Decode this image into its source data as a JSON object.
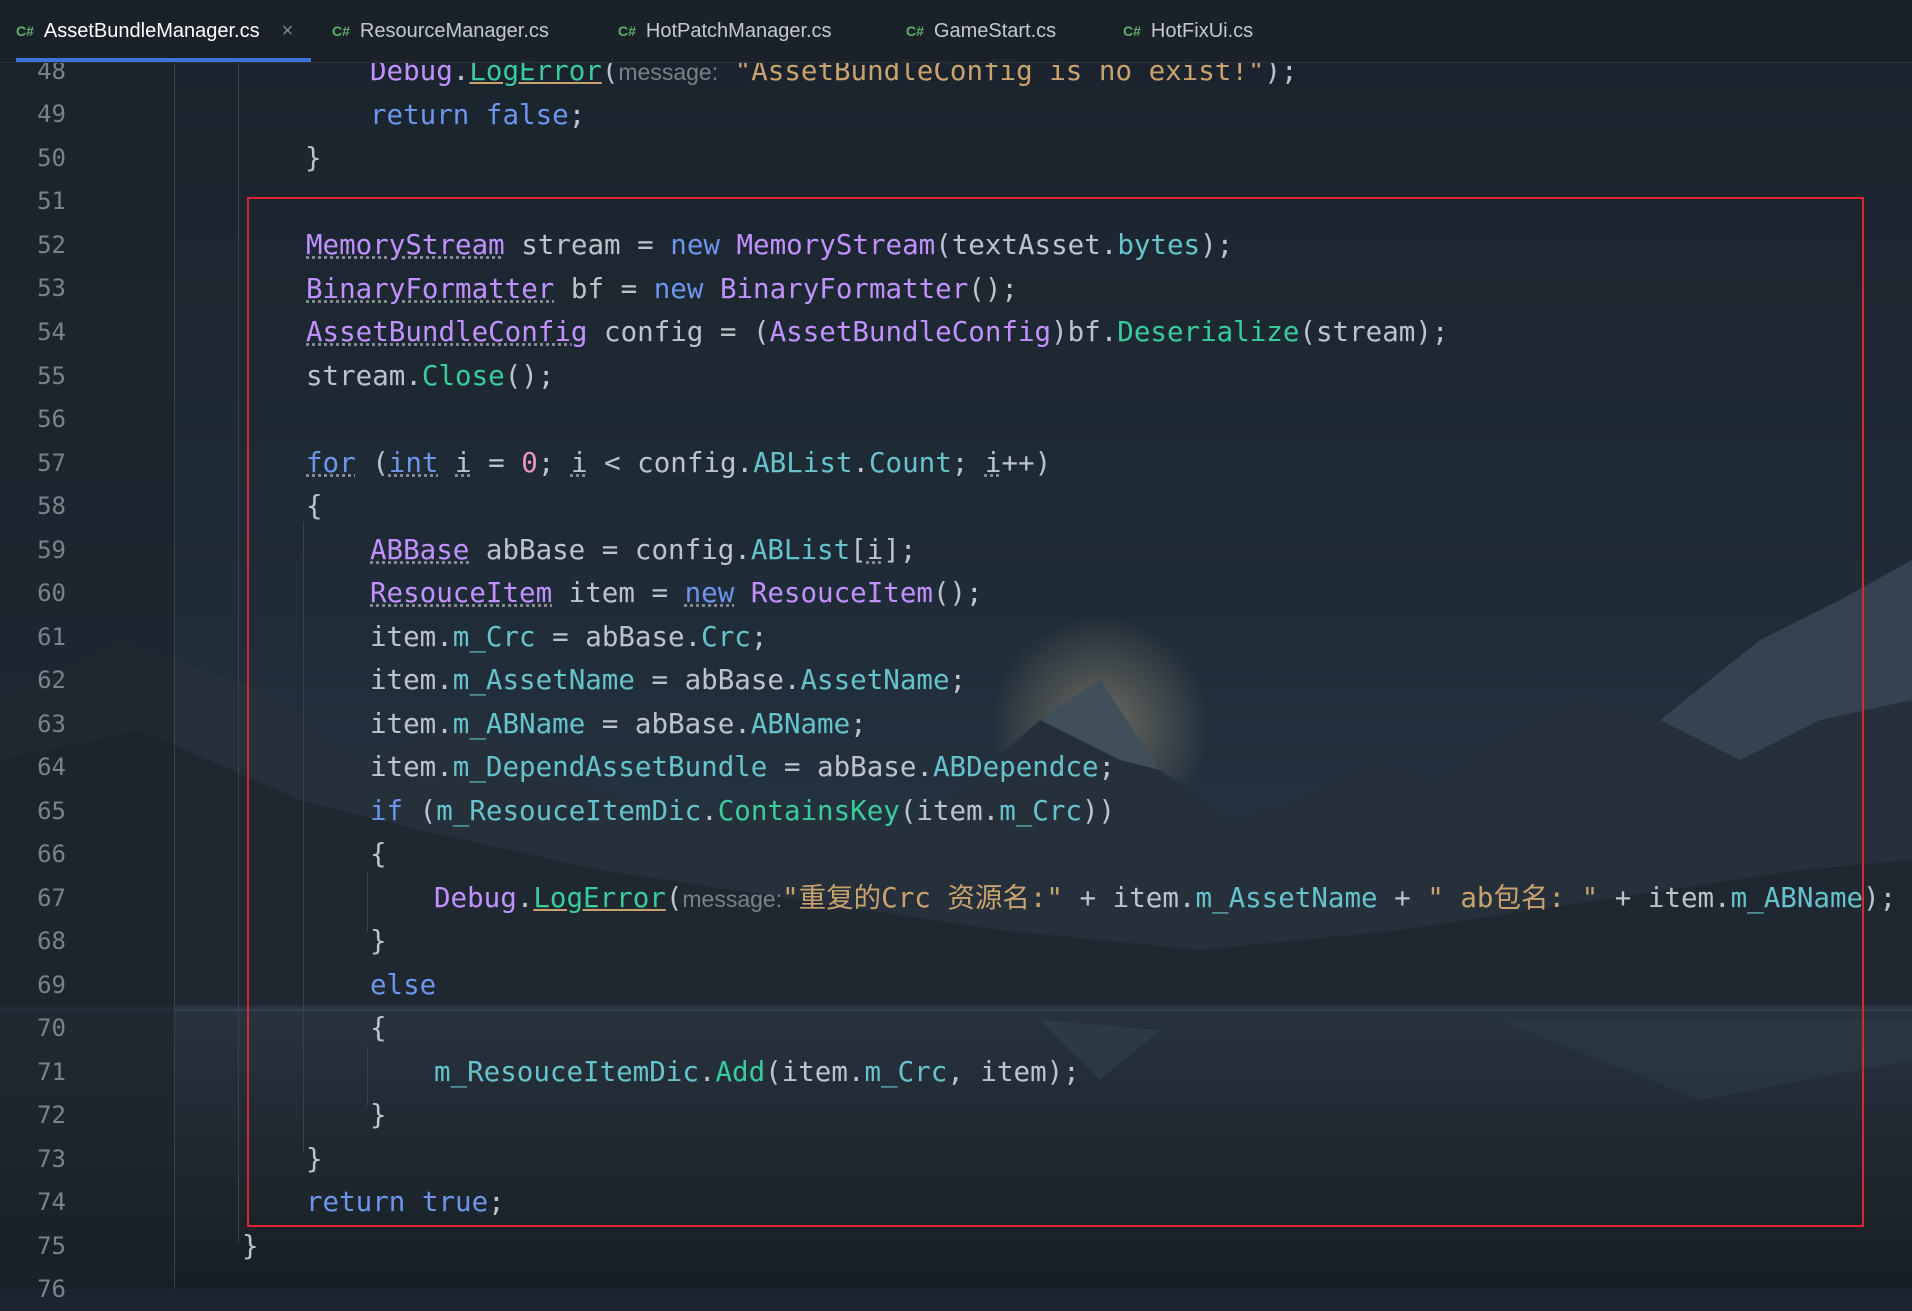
{
  "editor": {
    "tabs": [
      {
        "icon": "C#",
        "label": "AssetBundleManager.cs",
        "active": true,
        "close": "×"
      },
      {
        "icon": "C#",
        "label": "ResourceManager.cs"
      },
      {
        "icon": "C#",
        "label": "HotPatchManager.cs"
      },
      {
        "icon": "C#",
        "label": "GameStart.cs"
      },
      {
        "icon": "C#",
        "label": "HotFixUi.cs"
      }
    ],
    "line_numbers": [
      "48",
      "49",
      "50",
      "51",
      "52",
      "53",
      "54",
      "55",
      "56",
      "57",
      "58",
      "59",
      "60",
      "61",
      "62",
      "63",
      "64",
      "65",
      "66",
      "67",
      "68",
      "69",
      "70",
      "71",
      "72",
      "73",
      "74",
      "75",
      "76"
    ],
    "inlay_hint": "message:",
    "code": {
      "l48": {
        "debug": "Debug",
        "dot": ".",
        "logerror": "LogError",
        "paren": "(",
        "str": "\"AssetBundleConfig is no exist!\"",
        "end": ");"
      },
      "l49": {
        "ret": "return",
        "val": "false",
        "end": ";"
      },
      "l50": {
        "brace": "}"
      },
      "l52": {
        "t1": "MemoryStream",
        "a": " stream = ",
        "kw": "new",
        "sp": " ",
        "t2": "MemoryStream",
        "b": "(textAsset.",
        "m": "bytes",
        "c": ");"
      },
      "l53": {
        "t1": "BinaryFormatter",
        "a": " bf = ",
        "kw": "new",
        "sp": " ",
        "t2": "BinaryFormatter",
        "b": "();"
      },
      "l54": {
        "t1": "AssetBundleConfig",
        "a": " config = (",
        "t2": "AssetBundleConfig",
        "b": ")bf.",
        "m": "Deserialize",
        "c": "(stream);"
      },
      "l55": {
        "a": "stream.",
        "m": "Close",
        "b": "();"
      },
      "l57": {
        "kw1": "for",
        "a": " (",
        "kw2": "int",
        "sp": " ",
        "i1": "i",
        "b": " = ",
        "n": "0",
        "c": "; ",
        "i2": "i",
        "d": " < config.",
        "m1": "ABList",
        "e": ".",
        "m2": "Count",
        "f": "; ",
        "i3": "i",
        "g": "++)"
      },
      "l58": {
        "brace": "{"
      },
      "l59": {
        "t1": "ABBase",
        "a": " abBase = config.",
        "m": "ABList",
        "b": "[",
        "i": "i",
        "c": "];"
      },
      "l60": {
        "t1": "ResouceItem",
        "a": " item = ",
        "kw": "new",
        "sp": " ",
        "t2": "ResouceItem",
        "b": "();"
      },
      "l61": {
        "a": "item.",
        "m1": "m_Crc",
        "b": " = abBase.",
        "m2": "Crc",
        "c": ";"
      },
      "l62": {
        "a": "item.",
        "m1": "m_AssetName",
        "b": " = abBase.",
        "m2": "AssetName",
        "c": ";"
      },
      "l63": {
        "a": "item.",
        "m1": "m_ABName",
        "b": " = abBase.",
        "m2": "ABName",
        "c": ";"
      },
      "l64": {
        "a": "item.",
        "m1": "m_DependAssetBundle",
        "b": " = abBase.",
        "m2": "ABDependce",
        "c": ";"
      },
      "l65": {
        "kw": "if",
        "a": " (",
        "m1": "m_ResouceItemDic",
        "b": ".",
        "m2": "ContainsKey",
        "c": "(item.",
        "m3": "m_Crc",
        "d": "))"
      },
      "l66": {
        "brace": "{"
      },
      "l67": {
        "debug": "Debug",
        "dot": ".",
        "logerror": "LogError",
        "paren": "(",
        "s1": "\"重复的Crc 资源名:\"",
        "a": " + item.",
        "m1": "m_AssetName",
        "b": " + ",
        "s2": "\" ab包名: \"",
        "c": " + item.",
        "m2": "m_ABName",
        "d": ");"
      },
      "l68": {
        "brace": "}"
      },
      "l69": {
        "kw": "else"
      },
      "l70": {
        "brace": "{"
      },
      "l71": {
        "m1": "m_ResouceItemDic",
        "a": ".",
        "m2": "Add",
        "b": "(item.",
        "m3": "m_Crc",
        "c": ", item);"
      },
      "l72": {
        "brace": "}"
      },
      "l73": {
        "brace": "}"
      },
      "l74": {
        "kw": "return",
        "sp": " ",
        "val": "true",
        "end": ";"
      },
      "l75": {
        "brace": "}"
      }
    }
  },
  "colors": {
    "keyword": "#6c95eb",
    "type": "#c191ff",
    "member": "#66c3cc",
    "method": "#39cc9b",
    "string": "#c9a26d",
    "number": "#ed94c0",
    "highlight_box": "#e0242e",
    "active_tab_underline": "#3d74d6"
  }
}
